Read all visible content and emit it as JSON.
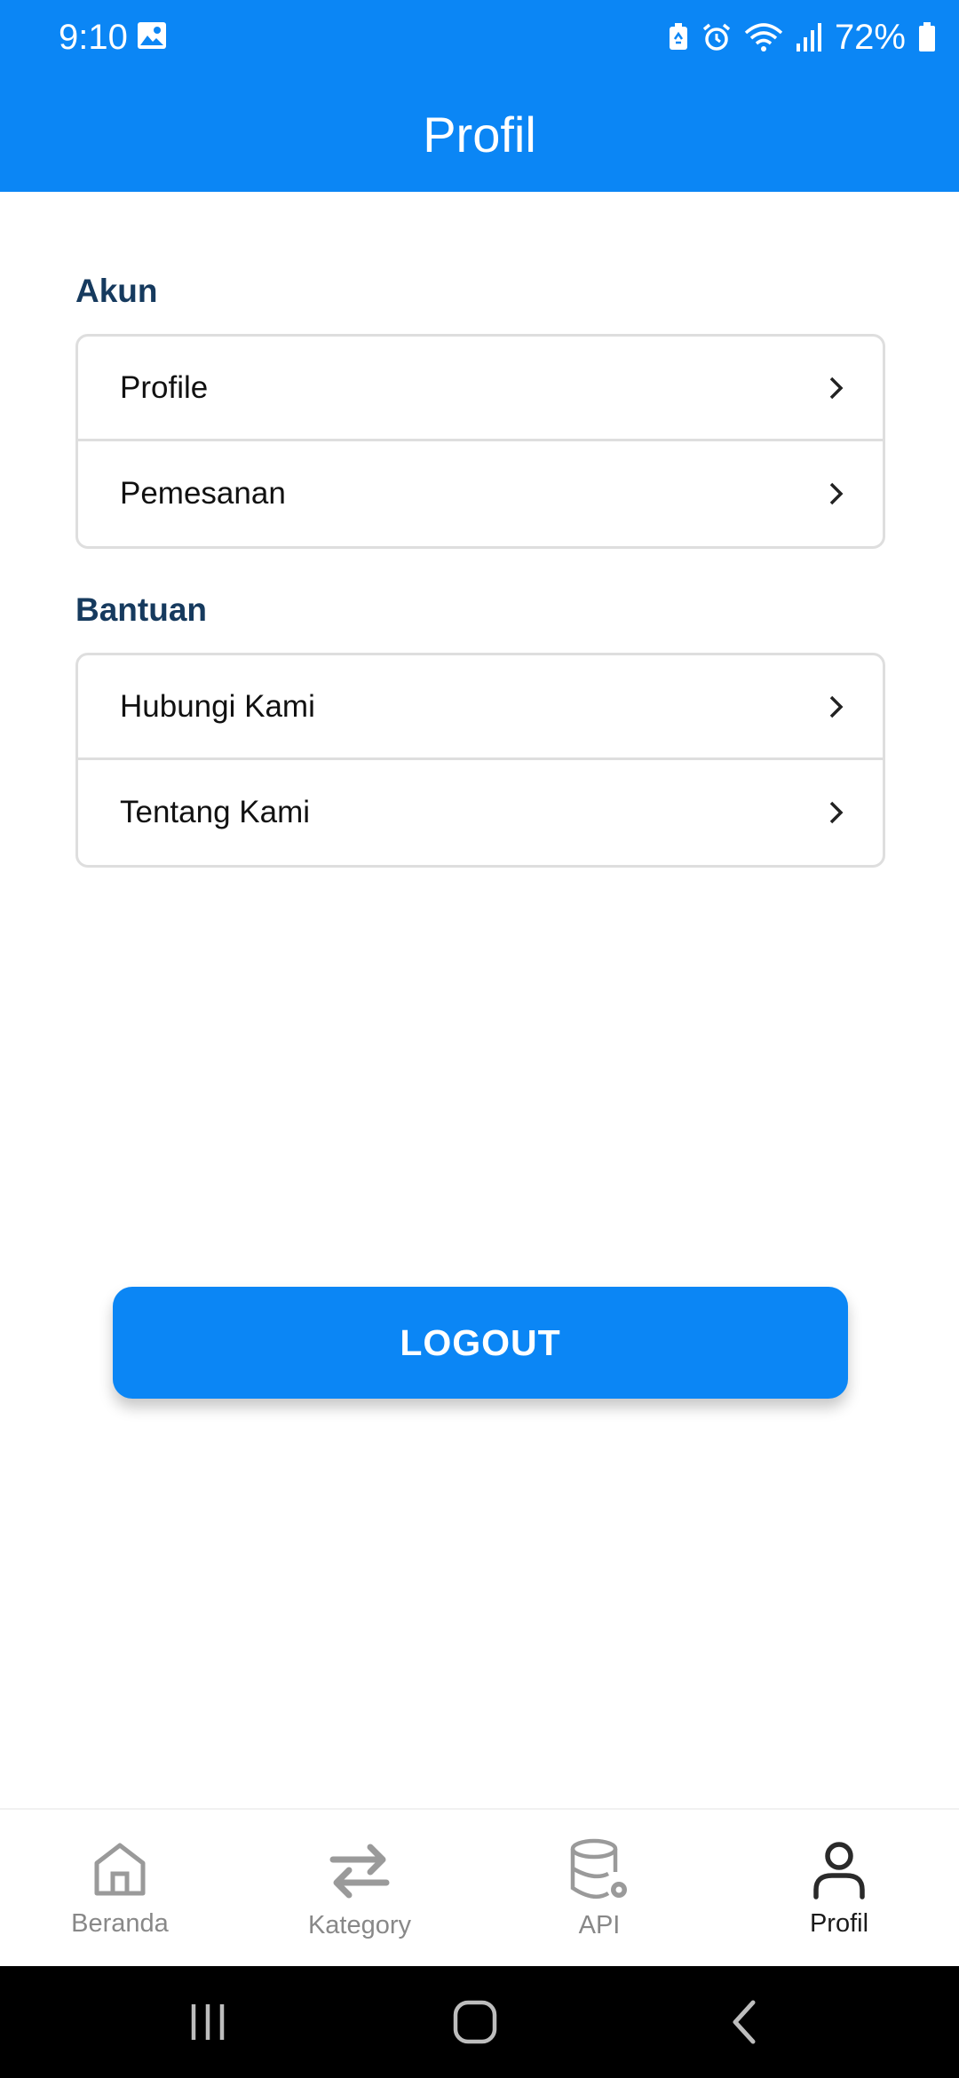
{
  "status_bar": {
    "time": "9:10",
    "battery": "72%"
  },
  "app_bar": {
    "title": "Profil"
  },
  "sections": [
    {
      "title": "Akun",
      "items": [
        {
          "label": "Profile"
        },
        {
          "label": "Pemesanan"
        }
      ]
    },
    {
      "title": "Bantuan",
      "items": [
        {
          "label": "Hubungi Kami"
        },
        {
          "label": "Tentang Kami"
        }
      ]
    }
  ],
  "logout": {
    "label": "LOGOUT"
  },
  "bottom_nav": {
    "items": [
      {
        "label": "Beranda",
        "icon": "home-icon"
      },
      {
        "label": "Kategory",
        "icon": "swap-arrows-icon"
      },
      {
        "label": "API",
        "icon": "database-settings-icon"
      },
      {
        "label": "Profil",
        "icon": "person-icon",
        "active": true
      }
    ]
  },
  "colors": {
    "primary": "#0b86f5",
    "section_title": "#163a5e",
    "nav_inactive": "#888888",
    "nav_active": "#1b1b1b"
  }
}
